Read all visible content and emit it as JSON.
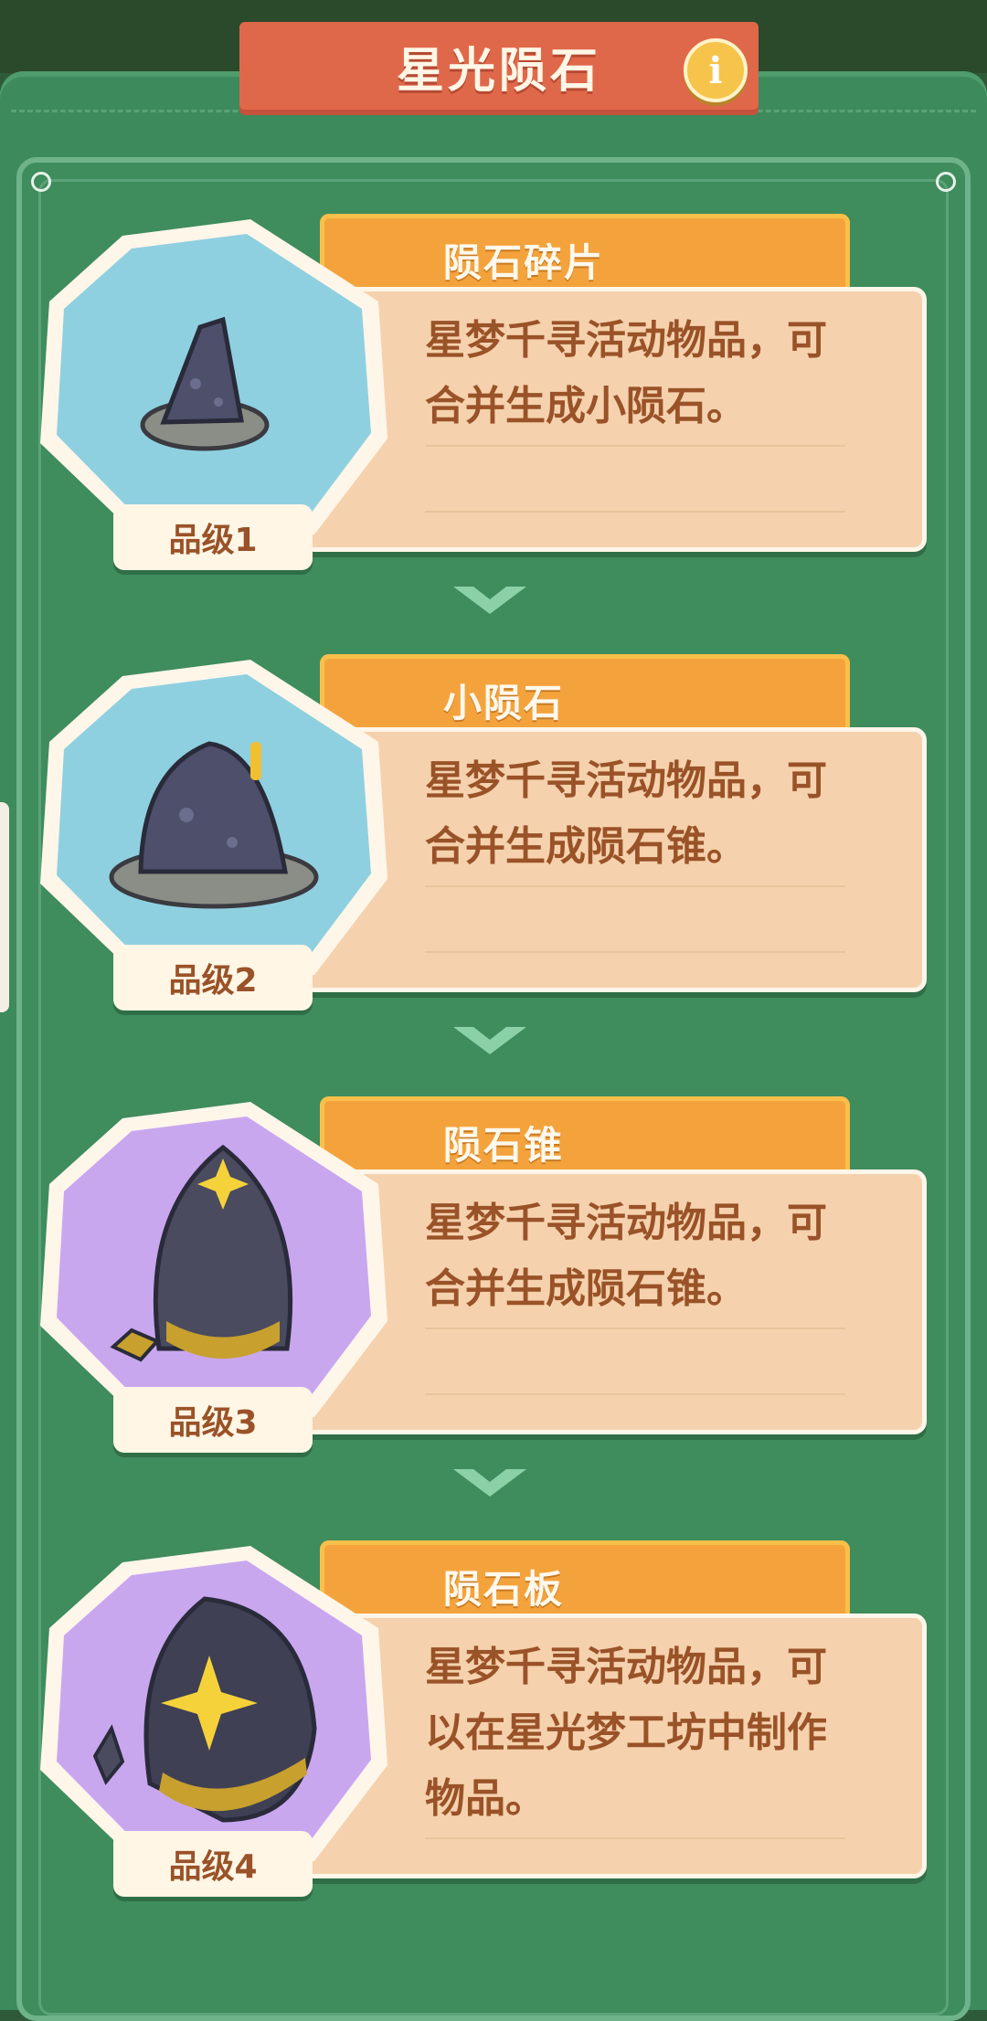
{
  "header": {
    "title": "星光陨石",
    "info_icon_text": "i"
  },
  "items": [
    {
      "name": "陨石碎片",
      "desc_lines": [
        "星梦千寻活动物品，可",
        "合并生成小陨石。"
      ],
      "grade": "品级1",
      "tier_color": "#8fd0e0",
      "icon": "rock-shard-icon"
    },
    {
      "name": "小陨石",
      "desc_lines": [
        "星梦千寻活动物品，可",
        "合并生成陨石锥。"
      ],
      "grade": "品级2",
      "tier_color": "#8fd0e0",
      "icon": "small-meteorite-icon"
    },
    {
      "name": "陨石锥",
      "desc_lines": [
        "星梦千寻活动物品，可",
        "合并生成陨石锥。"
      ],
      "grade": "品级3",
      "tier_color": "#c9a7ef",
      "icon": "meteorite-cone-icon"
    },
    {
      "name": "陨石板",
      "desc_lines": [
        "星梦千寻活动物品，可",
        "以在星光梦工坊中制作",
        "物品。"
      ],
      "grade": "品级4",
      "tier_color": "#c9a7ef",
      "icon": "meteorite-slab-icon"
    }
  ]
}
